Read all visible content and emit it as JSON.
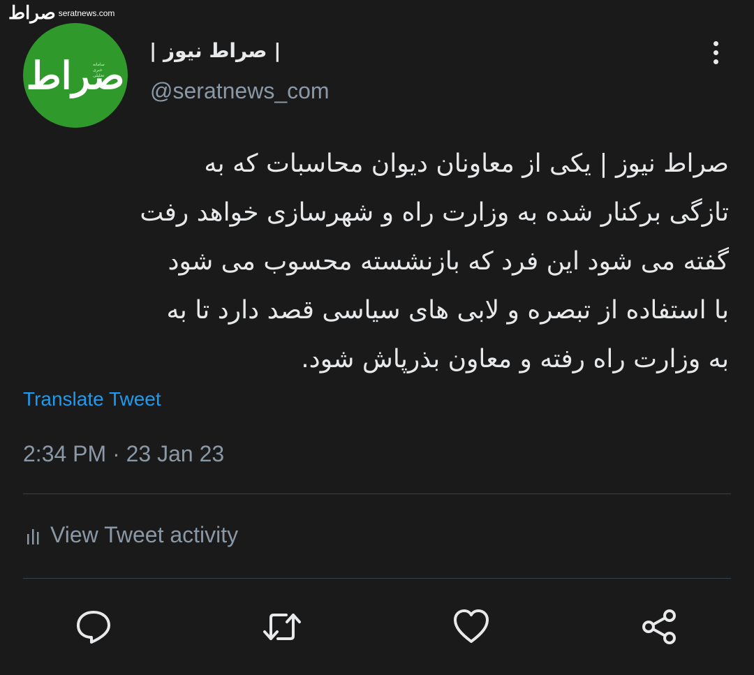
{
  "watermark": {
    "logo": "صراط",
    "url": "seratnews.com"
  },
  "author": {
    "avatar_text": "صراط",
    "avatar_subtext": "سامانه خبری تحلیلی",
    "display_name": "| صراط نیوز |",
    "handle": "@seratnews_com"
  },
  "tweet": {
    "text": "صراط نیوز | یکی از معاونان دیوان محاسبات که به\nتازگی برکنار شده به وزارت راه و شهرسازی خواهد رفت\nگفته می شود این فرد که بازنشسته محسوب می شود\nبا استفاده از تبصره و لابی های سیاسی قصد دارد تا به\nبه وزارت راه رفته و معاون بذرپاش شود.",
    "translate_label": "Translate Tweet",
    "timestamp": "2:34 PM · 23 Jan 23"
  },
  "activity": {
    "label": "View Tweet activity",
    "icon": "bar-chart-icon"
  },
  "actions": [
    {
      "name": "reply",
      "icon": "speech-bubble-icon"
    },
    {
      "name": "retweet",
      "icon": "retweet-icon"
    },
    {
      "name": "like",
      "icon": "heart-icon"
    },
    {
      "name": "share",
      "icon": "share-icon"
    }
  ],
  "colors": {
    "background": "#1a1a1b",
    "text": "#e7e9ea",
    "muted": "#8b98a5",
    "link": "#1d9bf0",
    "avatar_bg": "#2f9a2b",
    "divider": "#38444d"
  }
}
